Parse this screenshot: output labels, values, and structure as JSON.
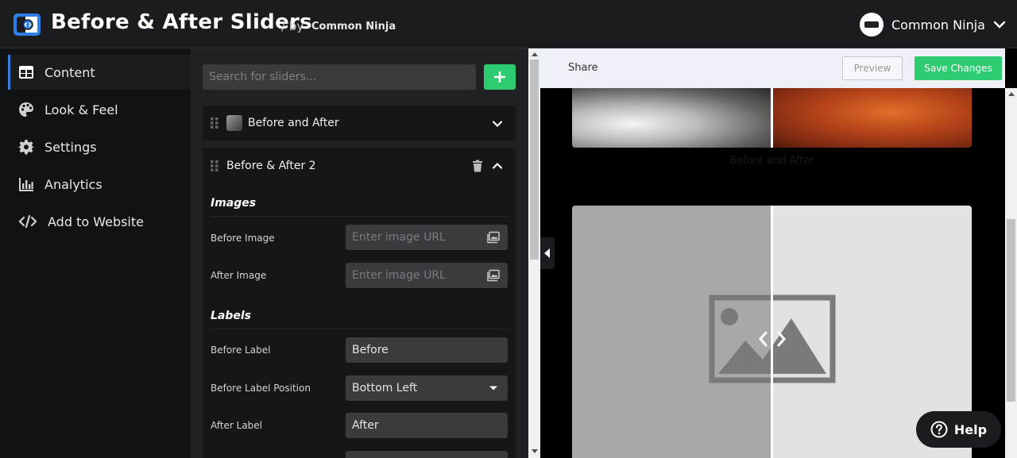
{
  "header": {
    "app_title": "Before & After Sliders",
    "by_text": "/ by",
    "brand": "Common Ninja",
    "user_name": "Common Ninja"
  },
  "sidebar": {
    "items": [
      {
        "label": "Content",
        "icon": "table-icon",
        "active": true
      },
      {
        "label": "Look & Feel",
        "icon": "palette-icon",
        "active": false
      },
      {
        "label": "Settings",
        "icon": "gear-icon",
        "active": false
      },
      {
        "label": "Analytics",
        "icon": "bar-chart-icon",
        "active": false
      },
      {
        "label": "Add to Website",
        "icon": "code-icon",
        "active": false
      }
    ]
  },
  "panel": {
    "search_placeholder": "Search for sliders...",
    "sliders": [
      {
        "title": "Before and After",
        "expanded": false
      },
      {
        "title": "Before & After 2",
        "expanded": true
      }
    ],
    "sections": {
      "images": "Images",
      "labels": "Labels"
    },
    "fields": {
      "before_image": {
        "label": "Before Image",
        "placeholder": "Enter image URL"
      },
      "after_image": {
        "label": "After Image",
        "placeholder": "Enter image URL"
      },
      "before_label": {
        "label": "Before Label",
        "value": "Before"
      },
      "before_label_position": {
        "label": "Before Label Position",
        "value": "Bottom Left"
      },
      "after_label": {
        "label": "After Label",
        "value": "After"
      }
    }
  },
  "preview": {
    "share": "Share",
    "preview_btn": "Preview",
    "save_btn": "Save Changes",
    "caption": "Before and After"
  },
  "help": {
    "label": "Help"
  },
  "colors": {
    "accent_green": "#2ecc71",
    "active_blue": "#3d7fe0",
    "sidebar_bg": "#111214",
    "panel_bg": "#202124"
  }
}
